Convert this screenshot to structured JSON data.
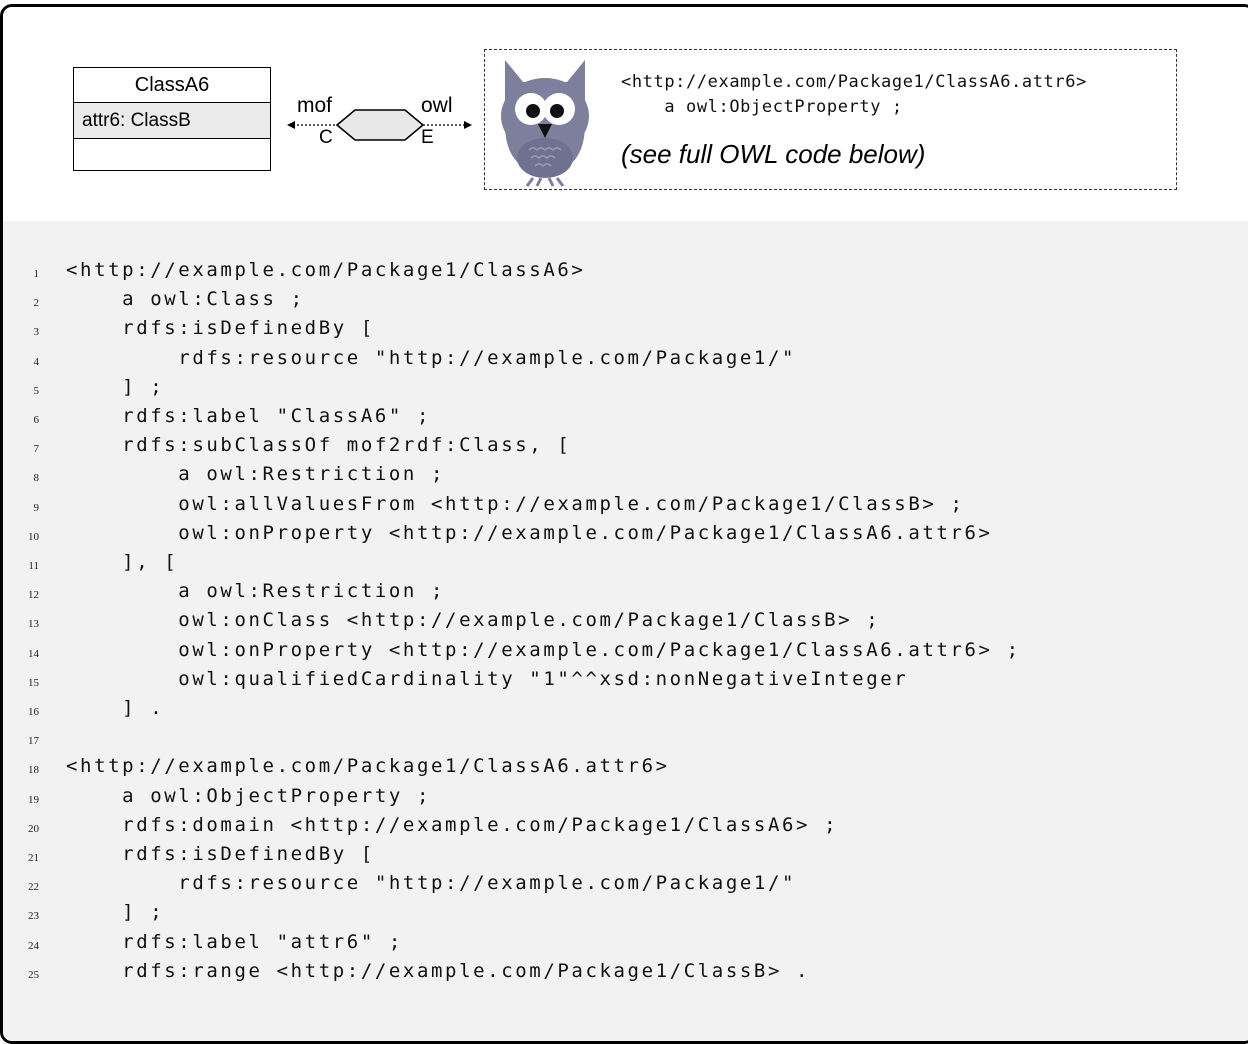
{
  "uml": {
    "class_name": "ClassA6",
    "attribute": "attr6: ClassB"
  },
  "mapping": {
    "left_label": "mof",
    "left_sub": "C",
    "right_label": "owl",
    "right_sub": "E"
  },
  "owl_box": {
    "code_line_1": "<http://example.com/Package1/ClassA6.attr6>",
    "code_line_2": "    a owl:ObjectProperty ;",
    "note": "(see full OWL code below)"
  },
  "code": {
    "lines": [
      {
        "n": "1",
        "t": "<http://example.com/Package1/ClassA6>"
      },
      {
        "n": "2",
        "t": "    a owl:Class ;"
      },
      {
        "n": "3",
        "t": "    rdfs:isDefinedBy ["
      },
      {
        "n": "4",
        "t": "        rdfs:resource \"http://example.com/Package1/\""
      },
      {
        "n": "5",
        "t": "    ] ;"
      },
      {
        "n": "6",
        "t": "    rdfs:label \"ClassA6\" ;"
      },
      {
        "n": "7",
        "t": "    rdfs:subClassOf mof2rdf:Class, ["
      },
      {
        "n": "8",
        "t": "        a owl:Restriction ;"
      },
      {
        "n": "9",
        "t": "        owl:allValuesFrom <http://example.com/Package1/ClassB> ;"
      },
      {
        "n": "10",
        "t": "        owl:onProperty <http://example.com/Package1/ClassA6.attr6>"
      },
      {
        "n": "11",
        "t": "    ], ["
      },
      {
        "n": "12",
        "t": "        a owl:Restriction ;"
      },
      {
        "n": "13",
        "t": "        owl:onClass <http://example.com/Package1/ClassB> ;"
      },
      {
        "n": "14",
        "t": "        owl:onProperty <http://example.com/Package1/ClassA6.attr6> ;"
      },
      {
        "n": "15",
        "t": "        owl:qualifiedCardinality \"1\"^^xsd:nonNegativeInteger"
      },
      {
        "n": "16",
        "t": "    ] ."
      },
      {
        "n": "17",
        "t": ""
      },
      {
        "n": "18",
        "t": "<http://example.com/Package1/ClassA6.attr6>"
      },
      {
        "n": "19",
        "t": "    a owl:ObjectProperty ;"
      },
      {
        "n": "20",
        "t": "    rdfs:domain <http://example.com/Package1/ClassA6> ;"
      },
      {
        "n": "21",
        "t": "    rdfs:isDefinedBy ["
      },
      {
        "n": "22",
        "t": "        rdfs:resource \"http://example.com/Package1/\""
      },
      {
        "n": "23",
        "t": "    ] ;"
      },
      {
        "n": "24",
        "t": "    rdfs:label \"attr6\" ;"
      },
      {
        "n": "25",
        "t": "    rdfs:range <http://example.com/Package1/ClassB> ."
      }
    ]
  },
  "colors": {
    "owl_body": "#7d7f9c",
    "code_background": "#f2f2f2",
    "attribute_fill": "#ebebeb",
    "hexagon_fill": "#e8e8e8"
  },
  "icons": [
    "owl-mascot-icon",
    "hexagon-transform-icon"
  ]
}
